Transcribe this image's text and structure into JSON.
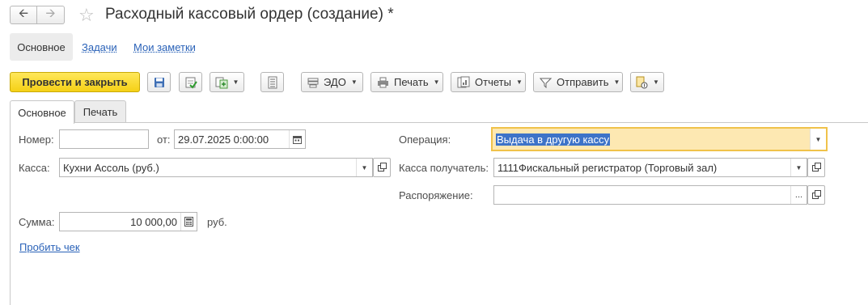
{
  "window": {
    "title": "Расходный кассовый ордер (создание) *"
  },
  "sections": {
    "main": "Основное",
    "tasks": "Задачи",
    "notes": "Мои заметки"
  },
  "toolbar": {
    "post_close": "Провести и закрыть",
    "edo": "ЭДО",
    "print": "Печать",
    "reports": "Отчеты",
    "send": "Отправить"
  },
  "form_tabs": {
    "main": "Основное",
    "print": "Печать"
  },
  "form": {
    "number_label": "Номер:",
    "number_value": "",
    "date_label": "от:",
    "date_value": "29.07.2025  0:00:00",
    "cashbox_label": "Касса:",
    "cashbox_value": "Кухни Ассоль (руб.)",
    "operation_label": "Операция:",
    "operation_value": "Выдача в другую кассу",
    "recipient_label": "Касса получатель:",
    "recipient_value": "1111Фискальный регистратор (Торговый зал)",
    "order_label": "Распоряжение:",
    "order_value": "",
    "order_btn": "...",
    "sum_label": "Сумма:",
    "sum_value": "10 000,00",
    "currency": "руб.",
    "receipt_link": "Пробить чек"
  },
  "icons": {
    "back": "arrow-left-icon",
    "forward": "arrow-right-icon",
    "favorite": "star-icon",
    "save": "floppy-disk-icon",
    "post": "post-document-icon",
    "create_based": "create-based-on-icon",
    "structure": "document-structure-icon",
    "edo": "edo-icon",
    "print": "printer-icon",
    "reports": "reports-icon",
    "send": "send-icon",
    "attach": "attachments-icon",
    "calendar": "calendar-icon",
    "calculator": "calculator-icon",
    "open": "open-link-icon"
  },
  "colors": {
    "primary_button": "#f5d116",
    "link": "#2a62b8",
    "active_field": "#fde8b2",
    "selection": "#3d73c8"
  }
}
